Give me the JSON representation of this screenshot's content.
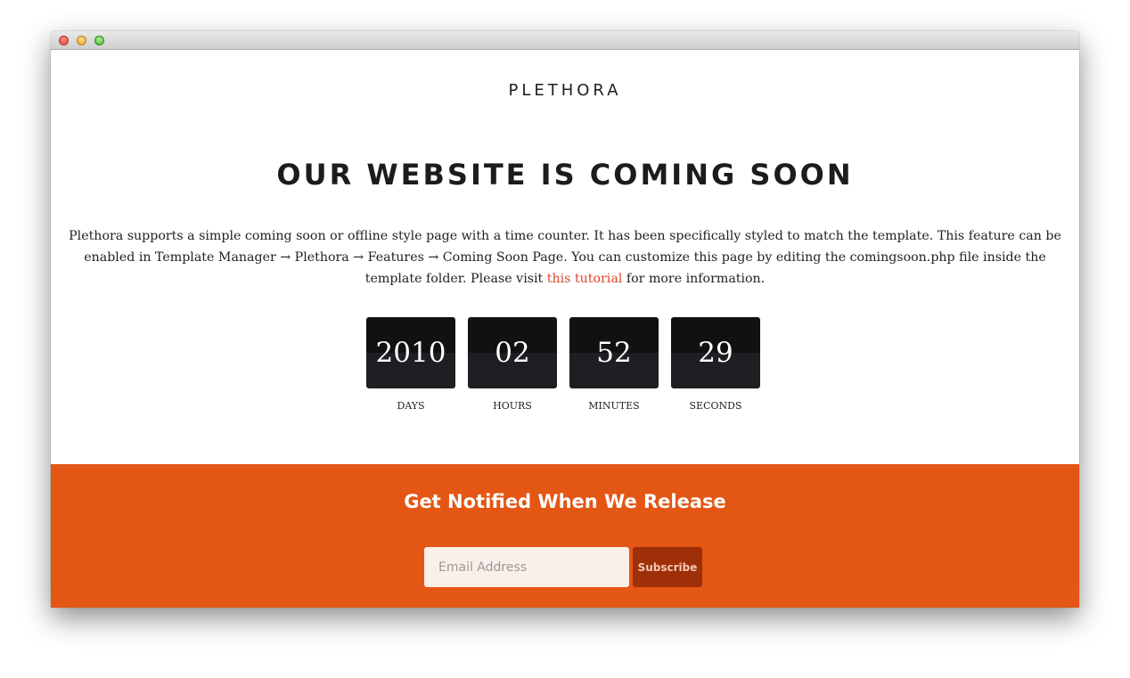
{
  "brand": "PLETHORA",
  "headline": "OUR WEBSITE IS COMING SOON",
  "intro": {
    "text_before_link": "Plethora supports a simple coming soon or offline style page with a time counter. It has been specifically styled to match the template. This feature can be enabled in Template Manager → Plethora → Features → Coming Soon Page. You can customize this page by editing the comingsoon.php file inside the template folder. Please visit ",
    "link_text": "this tutorial",
    "text_after_link": " for more information."
  },
  "countdown": {
    "days": {
      "value": "2010",
      "label": "DAYS"
    },
    "hours": {
      "value": "02",
      "label": "HOURS"
    },
    "minutes": {
      "value": "52",
      "label": "MINUTES"
    },
    "seconds": {
      "value": "29",
      "label": "SECONDS"
    }
  },
  "notify": {
    "title": "Get Notified When We Release",
    "email_placeholder": "Email Address",
    "subscribe_label": "Subscribe"
  },
  "colors": {
    "accent": "#e35614",
    "button": "#9e2f08",
    "link": "#d9472b",
    "counter_bg": "#111114"
  },
  "window_controls": [
    "close-icon",
    "minimize-icon",
    "zoom-icon"
  ]
}
